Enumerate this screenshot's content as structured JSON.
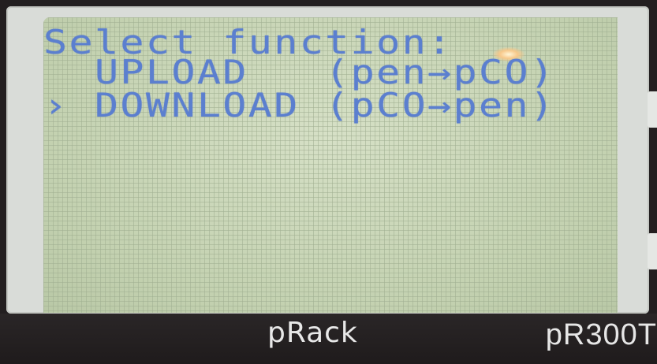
{
  "screen": {
    "title": "Select function:",
    "menu": [
      {
        "label": "  UPLOAD   (pen→pCO)",
        "selected": false
      },
      {
        "label": "› DOWNLOAD (pCO→pen)",
        "selected": true
      }
    ]
  },
  "device": {
    "brand": "pRack",
    "model": "pR300T"
  },
  "colors": {
    "lcd_background": "#c8d6b6",
    "lcd_text": "#5b7fcf",
    "bezel": "#d9dcd8",
    "body": "#231f20"
  }
}
